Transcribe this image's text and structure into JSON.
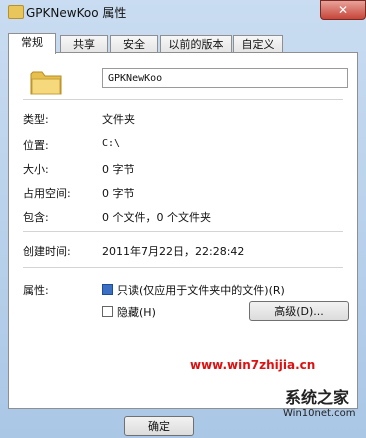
{
  "window": {
    "title": "GPKNewKoo 属性",
    "close_label": "✕"
  },
  "tabs": [
    {
      "label": "常规"
    },
    {
      "label": "共享"
    },
    {
      "label": "安全"
    },
    {
      "label": "以前的版本"
    },
    {
      "label": "自定义"
    }
  ],
  "general": {
    "name_value": "GPKNewKoo",
    "rows": [
      {
        "label": "类型:",
        "value": "文件夹"
      },
      {
        "label": "位置:",
        "value": "C:\\"
      },
      {
        "label": "大小:",
        "value": "0 字节"
      },
      {
        "label": "占用空间:",
        "value": "0 字节"
      },
      {
        "label": "包含:",
        "value": "0 个文件，0 个文件夹"
      },
      {
        "label": "创建时间:",
        "value": "2011年7月22日，22:28:42"
      }
    ],
    "attributes_label": "属性:",
    "readonly_label": "只读(仅应用于文件夹中的文件)(R)",
    "hidden_label": "隐藏(H)",
    "advanced_label": "高级(D)...",
    "readonly_checked": true,
    "hidden_checked": false
  },
  "footer": {
    "ok_label": "确定"
  },
  "watermark": {
    "text1": "www.win7zhijia.cn",
    "text2": "系统之家",
    "text3": "Win10net.com"
  }
}
